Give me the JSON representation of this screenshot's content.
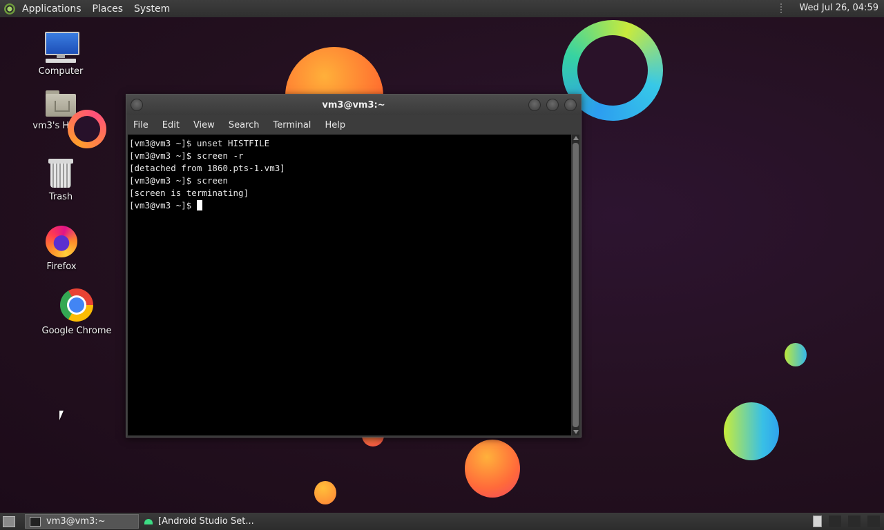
{
  "top_panel": {
    "menus": [
      "Applications",
      "Places",
      "System"
    ],
    "clock": "Wed Jul 26, 04:59"
  },
  "desktop_icons": [
    {
      "label": "Computer",
      "icon": "computer-icon"
    },
    {
      "label": "vm3's Home",
      "icon": "home-folder-icon"
    },
    {
      "label": "Trash",
      "icon": "trash-icon"
    },
    {
      "label": "Firefox",
      "icon": "firefox-icon"
    },
    {
      "label": "Google Chrome",
      "icon": "chrome-icon"
    }
  ],
  "terminal": {
    "title": "vm3@vm3:~",
    "menu": [
      "File",
      "Edit",
      "View",
      "Search",
      "Terminal",
      "Help"
    ],
    "lines": [
      "[vm3@vm3 ~]$ unset HISTFILE",
      "[vm3@vm3 ~]$ screen -r",
      "[detached from 1860.pts-1.vm3]",
      "[vm3@vm3 ~]$ screen",
      "[screen is terminating]",
      "[vm3@vm3 ~]$ "
    ]
  },
  "taskbar": {
    "tasks": [
      {
        "label": "vm3@vm3:~",
        "icon": "terminal-icon",
        "active": true
      },
      {
        "label": "[Android Studio Set...",
        "icon": "android-icon",
        "active": false
      }
    ]
  },
  "colors": {
    "desktop_bg": "#23101f",
    "panel_bg": "#333333",
    "terminal_bg": "#000000"
  }
}
